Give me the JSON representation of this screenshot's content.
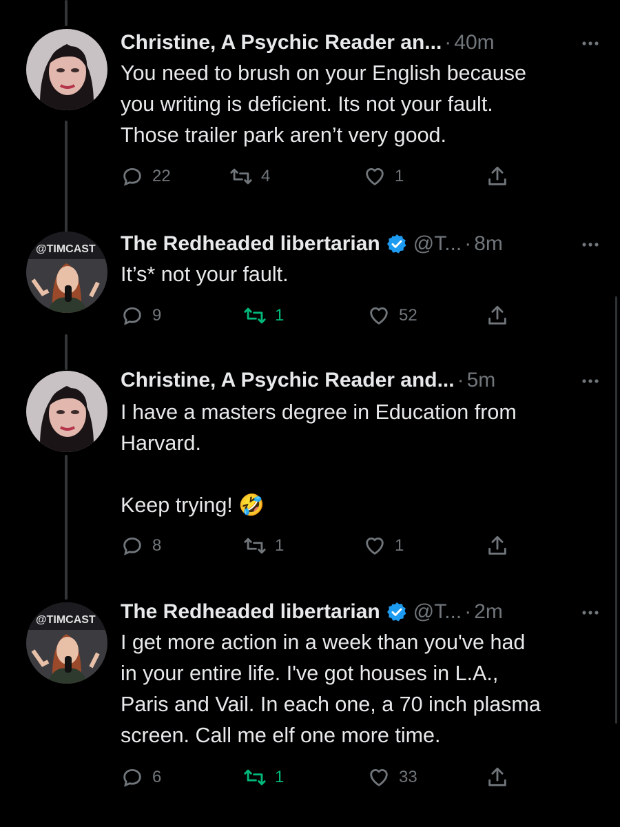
{
  "colors": {
    "background": "#000000",
    "text": "#e7e9ea",
    "muted": "#71767b",
    "verified": "#1d9bf0",
    "retweet_active": "#00ba7c",
    "thread_line": "#333639"
  },
  "tweets": [
    {
      "name": "Christine, A Psychic Reader an...",
      "handle": "",
      "time": "40m",
      "verified": false,
      "text": "You need to brush on your English because\nyou writing is deficient. Its not your fault.\nThose trailer park aren’t very good.",
      "replies": "22",
      "retweets": "4",
      "retweeted": false,
      "likes": "1"
    },
    {
      "name": "The Redheaded libertarian",
      "handle": "@T...",
      "time": "8m",
      "verified": true,
      "text": "It’s* not your fault.",
      "replies": "9",
      "retweets": "1",
      "retweeted": true,
      "likes": "52"
    },
    {
      "name": "Christine, A Psychic Reader and...",
      "handle": "",
      "time": "5m",
      "verified": false,
      "text": "I have a masters degree in Education from\nHarvard.\n\nKeep trying! 🤣",
      "replies": "8",
      "retweets": "1",
      "retweeted": false,
      "likes": "1"
    },
    {
      "name": "The Redheaded libertarian",
      "handle": "@T...",
      "time": "2m",
      "verified": true,
      "text": "I get more action in a week than you've had\nin your entire life. I've got houses in L.A.,\nParis and Vail. In each one, a 70 inch plasma\nscreen. Call me elf one more time.",
      "replies": "6",
      "retweets": "1",
      "retweeted": true,
      "likes": "33"
    }
  ],
  "avatars": {
    "christine": {
      "description_icon": "woman-portrait-avatar"
    },
    "redheaded": {
      "description_icon": "podcast-host-avatar",
      "logo_text": "@TIMCAST"
    }
  }
}
